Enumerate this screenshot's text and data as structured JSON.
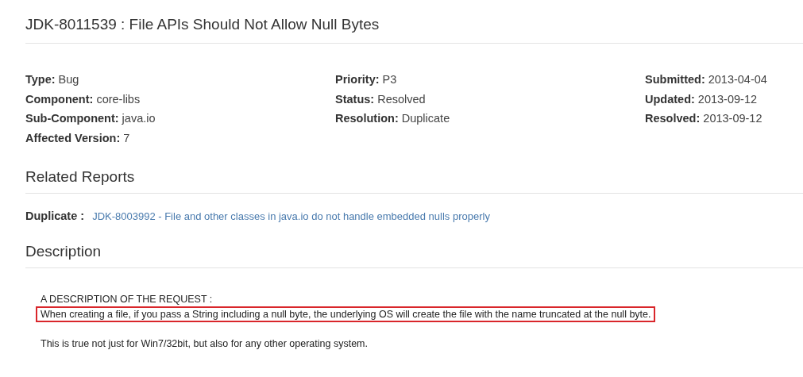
{
  "title": "JDK-8011539 : File APIs Should Not Allow Null Bytes",
  "field_columns": [
    [
      {
        "label": "Type:",
        "value": "Bug"
      },
      {
        "label": "Component:",
        "value": "core-libs"
      },
      {
        "label": "Sub-Component:",
        "value": "java.io"
      },
      {
        "label": "Affected Version:",
        "value": "7"
      }
    ],
    [
      {
        "label": "Priority:",
        "value": "P3"
      },
      {
        "label": "Status:",
        "value": "Resolved"
      },
      {
        "label": "Resolution:",
        "value": "Duplicate"
      }
    ],
    [
      {
        "label": "Submitted:",
        "value": "2013-04-04"
      },
      {
        "label": "Updated:",
        "value": "2013-09-12"
      },
      {
        "label": "Resolved:",
        "value": "2013-09-12"
      }
    ]
  ],
  "related_reports": {
    "heading": "Related Reports",
    "items": [
      {
        "label": "Duplicate :",
        "link": "JDK-8003992 - File and other classes in java.io do not handle embedded nulls properly"
      }
    ]
  },
  "description": {
    "heading": "Description",
    "paragraphs": [
      {
        "lines": [
          {
            "text": "A DESCRIPTION OF THE REQUEST :",
            "highlighted": false
          },
          {
            "text": "When creating a file, if you pass a String including a null byte, the underlying OS will create the file with the name truncated at the null byte.",
            "highlighted": true
          }
        ]
      },
      {
        "lines": [
          {
            "text": "This is true not just for Win7/32bit, but also for any other operating system.",
            "highlighted": false
          }
        ]
      }
    ]
  }
}
